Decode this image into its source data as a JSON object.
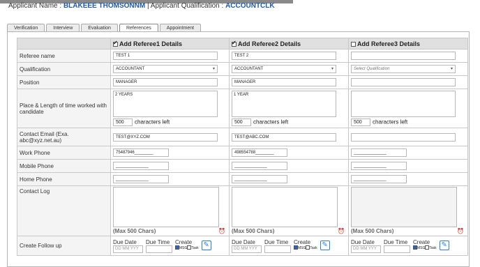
{
  "applicant": {
    "name_label": "Applicant Name : ",
    "name": "BLAKEEE THOMSONNM",
    "sep": " | ",
    "qual_label": "Applicant Qualification : ",
    "qual": "ACCOUNTCLK"
  },
  "tabs": [
    {
      "label": "Verification"
    },
    {
      "label": "Interview"
    },
    {
      "label": "Evaluation"
    },
    {
      "label": "References",
      "active": true
    },
    {
      "label": "Appointment"
    }
  ],
  "columns": [
    {
      "header": "Add Referee1 Details",
      "checked": true
    },
    {
      "header": "Add Referee2 Details",
      "checked": true
    },
    {
      "header": "Add Referee3 Details",
      "checked": false
    }
  ],
  "labels": {
    "referee_name": "Referee name",
    "qualification": "Qualification",
    "position": "Position",
    "place_length": "Place & Length of time worked with candidate",
    "contact_email": "Contact Email (Exa. abc@xyz.net.au)",
    "work_phone": "Work Phone",
    "mobile_phone": "Mobile Phone",
    "home_phone": "Home Phone",
    "contact_log": "Contact Log",
    "create_follow_up": "Create Follow up"
  },
  "referees": [
    {
      "name": "TEST 1",
      "qualification": "ACCOUNTANT",
      "position": "MANAGER",
      "place": "2 YEARS",
      "chars_left": "500",
      "email": "TEST@XYZ.COM",
      "work_phone": "75487946________",
      "mobile_phone": "______________",
      "home_phone": "______________",
      "contact_log": ""
    },
    {
      "name": "TEST 2",
      "qualification": "ACCOUNTANT",
      "position": "MANAGER",
      "place": "1 YEAR",
      "chars_left": "500",
      "email": "TEST@ABC.COM",
      "work_phone": "498554788________",
      "mobile_phone": "______________",
      "home_phone": "______________",
      "contact_log": ""
    },
    {
      "name": "",
      "qualification": "",
      "position": "",
      "place": "",
      "chars_left": "500",
      "email": "",
      "work_phone": "______________",
      "mobile_phone": "______________",
      "home_phone": "______________",
      "contact_log": ""
    }
  ],
  "common": {
    "chars_left_label": "characters left",
    "qual_placeholder": "Select Qualification",
    "max_chars": "(Max 500 Chars)",
    "due_date": "Due Date",
    "due_time": "Due Time",
    "create": "Create",
    "date_placeholder": "DD MM YYY",
    "msg": "MSG",
    "task": "Task"
  }
}
